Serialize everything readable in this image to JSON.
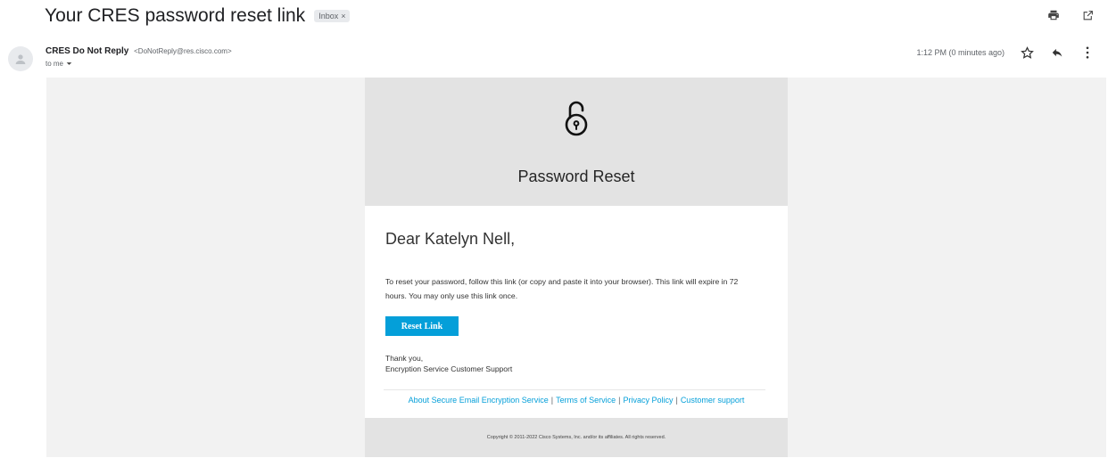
{
  "subject": "Your CRES password reset link",
  "label": {
    "name": "Inbox",
    "close": "×"
  },
  "sender": {
    "name": "CRES Do Not Reply",
    "email": "<DoNotReply@res.cisco.com>",
    "to": "to me"
  },
  "timestamp": "1:12 PM (0 minutes ago)",
  "icons": {
    "print": "print-icon",
    "open_new_window": "open-in-new-window-icon",
    "star": "star-icon",
    "reply": "reply-icon",
    "more": "more-vertical-icon",
    "avatar": "person-icon",
    "lock": "unlocked-padlock-icon"
  },
  "email": {
    "header_title": "Password Reset",
    "greeting": "Dear Katelyn Nell,",
    "body_line1": "To reset your password, follow this link (or copy and paste it into your browser). This link will expire in 72",
    "body_line2": "hours. You may only use this link once.",
    "button_label": "Reset Link",
    "thanks": "Thank you,",
    "signature": "Encryption Service Customer Support",
    "footer_links": [
      "About Secure Email Encryption Service",
      "Terms of Service",
      "Privacy Policy",
      "Customer support"
    ],
    "copyright": "Copyright © 2011-2022 Cisco Systems, Inc. and/or its affiliates. All rights reserved."
  },
  "colors": {
    "accent": "#049fd9",
    "header_band": "#e3e3e3",
    "outer_bg": "#f2f2f2"
  }
}
